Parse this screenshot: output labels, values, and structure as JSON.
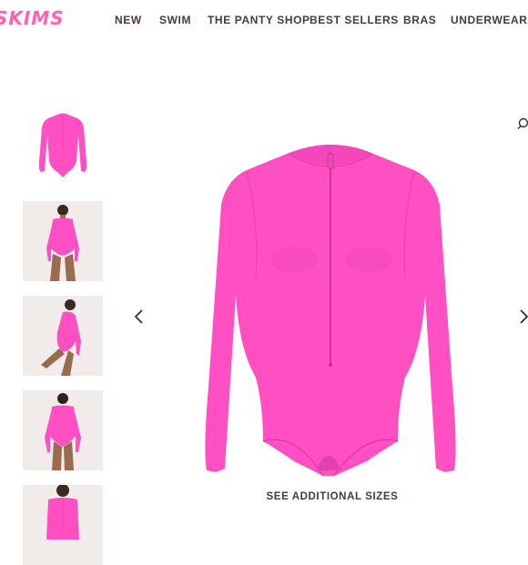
{
  "brand": {
    "logo_text": "SKIMS",
    "accent_color": "#ff5fb8"
  },
  "nav": {
    "items": [
      {
        "label": "NEW"
      },
      {
        "label": "SWIM"
      },
      {
        "label": "THE PANTY SHOP"
      },
      {
        "label": "BEST SELLERS"
      },
      {
        "label": "BRAS"
      },
      {
        "label": "UNDERWEAR"
      }
    ]
  },
  "gallery": {
    "thumbnail_count": 5,
    "prev_icon": "chevron-left-icon",
    "next_icon": "chevron-right-icon",
    "zoom_icon": "magnifier-icon",
    "product_color": "#ff4fc3",
    "additional_sizes_label": "SEE ADDITIONAL SIZES"
  }
}
